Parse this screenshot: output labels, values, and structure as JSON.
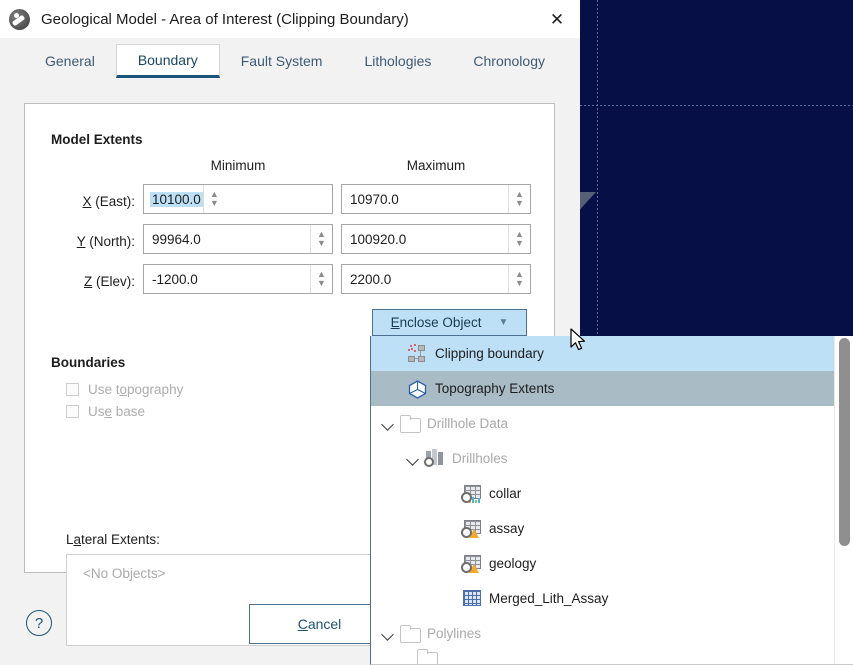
{
  "window": {
    "title": "Geological Model - Area of Interest (Clipping Boundary)",
    "app_icon": "leapfrog-logo-icon",
    "close_icon": "✕"
  },
  "tabs": [
    {
      "label": "General",
      "active": false
    },
    {
      "label": "Boundary",
      "active": true
    },
    {
      "label": "Fault System",
      "active": false
    },
    {
      "label": "Lithologies",
      "active": false
    },
    {
      "label": "Chronology",
      "active": false
    }
  ],
  "model_extents": {
    "section_title": "Model Extents",
    "column_headers": {
      "minimum": "Minimum",
      "maximum": "Maximum"
    },
    "rows": [
      {
        "label_pre": "X",
        "label_post": " (East):",
        "min": "10100.0",
        "max": "10970.0",
        "min_selected": true
      },
      {
        "label_pre": "Y",
        "label_post": " (North):",
        "min": "99964.0",
        "max": "100920.0",
        "min_selected": false
      },
      {
        "label_pre": "Z",
        "label_post": " (Elev):",
        "min": "-1200.0",
        "max": "2200.0",
        "min_selected": false
      }
    ]
  },
  "boundaries": {
    "section_title": "Boundaries",
    "use_topography": {
      "pre": "Use t",
      "key": "o",
      "post": "pography",
      "checked": false,
      "disabled": true
    },
    "use_base": {
      "pre": "Us",
      "key": "e",
      "post": " base",
      "checked": false,
      "disabled": true
    },
    "lateral_extents_label": {
      "pre": "L",
      "key": "a",
      "post": "teral Extents:"
    },
    "lateral_extents_placeholder": "<No Objects>"
  },
  "enclose_button": {
    "key": "E",
    "label_rest": "nclose Object",
    "chevron": "chevron-down-icon"
  },
  "dropdown": {
    "items": [
      {
        "label": "Clipping boundary",
        "icon": "clipping-boundary-icon",
        "state": "highlighted",
        "indent": 0,
        "twisty": false,
        "dim": false
      },
      {
        "label": "Topography Extents",
        "icon": "topography-extents-icon",
        "state": "selected",
        "indent": 0,
        "twisty": false,
        "dim": false
      },
      {
        "label": "Drillhole Data",
        "icon": "folder-icon",
        "state": "normal",
        "indent": 0,
        "twisty": true,
        "dim": true
      },
      {
        "label": "Drillholes",
        "icon": "drillholes-icon",
        "state": "normal",
        "indent": 1,
        "twisty": true,
        "dim": true
      },
      {
        "label": "collar",
        "icon": "table-collar-icon",
        "state": "normal",
        "indent": 2,
        "twisty": false,
        "dim": false
      },
      {
        "label": "assay",
        "icon": "table-warning-icon",
        "state": "normal",
        "indent": 2,
        "twisty": false,
        "dim": false
      },
      {
        "label": "geology",
        "icon": "table-warning-icon",
        "state": "normal",
        "indent": 2,
        "twisty": false,
        "dim": false
      },
      {
        "label": "Merged_Lith_Assay",
        "icon": "table-blue-icon",
        "state": "normal",
        "indent": 2,
        "twisty": false,
        "dim": false
      },
      {
        "label": "Polylines",
        "icon": "folder-icon",
        "state": "normal",
        "indent": 0,
        "twisty": true,
        "dim": true
      },
      {
        "label": "",
        "icon": "folder-icon",
        "state": "normal",
        "indent": 0,
        "twisty": false,
        "dim": true
      }
    ]
  },
  "footer": {
    "help_label": "?",
    "cancel": {
      "key": "C",
      "label_rest": "ancel"
    }
  },
  "colors": {
    "viewport_bg": "#061046",
    "accent_blue": "#1b5476",
    "highlight": "#bde0f7",
    "selection_gray": "#a9bcc6",
    "panel_bg": "#ffffff",
    "dialog_bg": "#f2f2f2"
  }
}
